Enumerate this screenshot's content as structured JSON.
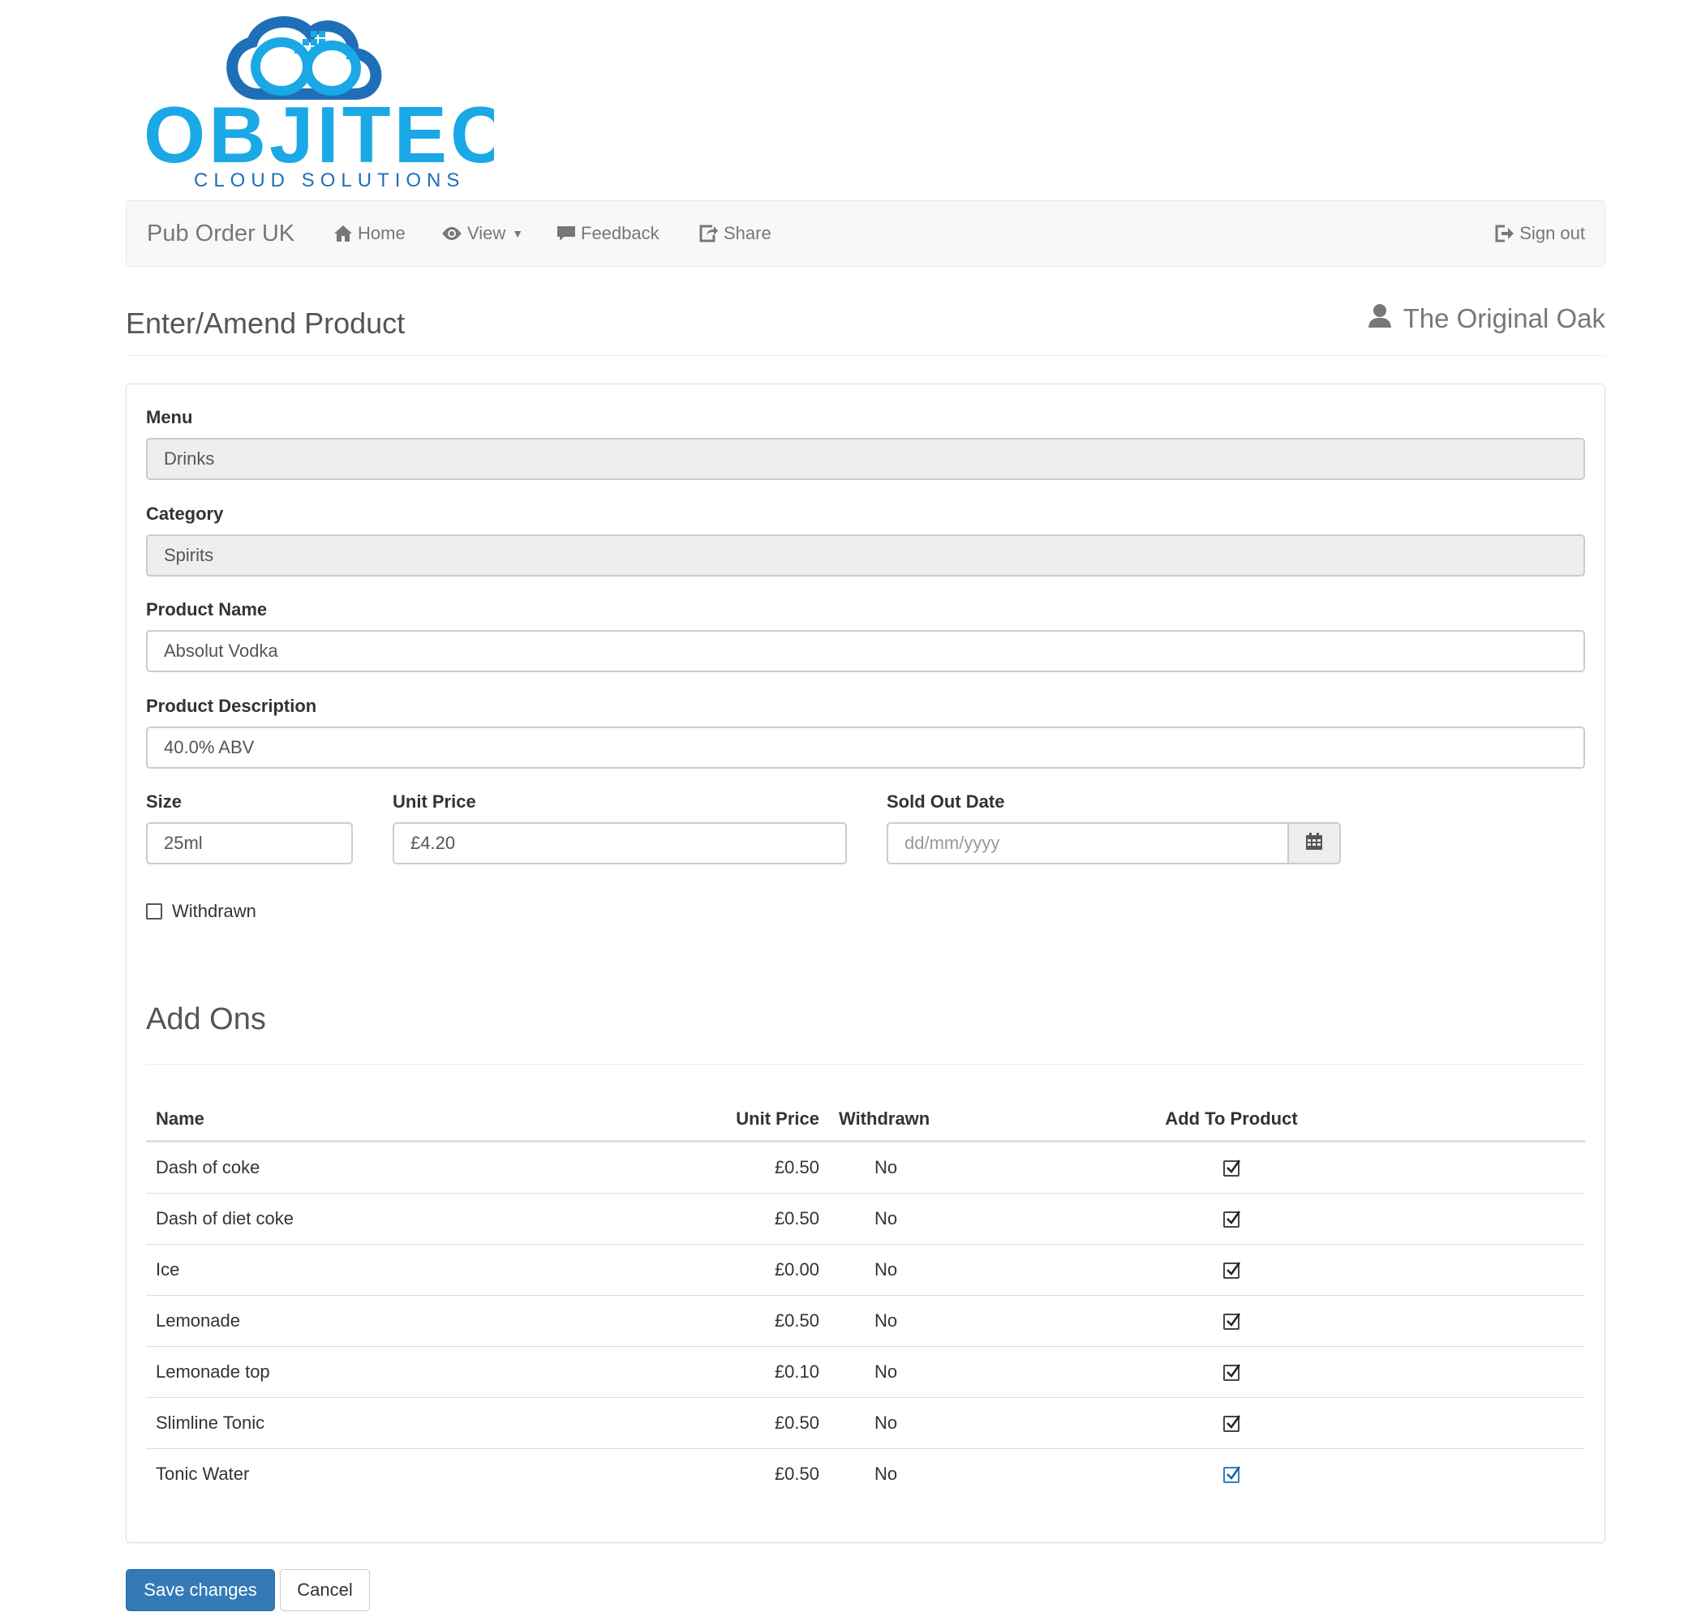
{
  "logo": {
    "wordmark": "OBJITEC",
    "tagline": "CLOUD SOLUTIONS",
    "colors": {
      "primary": "#1aa8e6",
      "dark": "#1f5aa8"
    }
  },
  "navbar": {
    "brand": "Pub Order UK",
    "items": [
      {
        "label": "Home",
        "icon": "home-icon"
      },
      {
        "label": "View",
        "icon": "eye-icon",
        "dropdown": true
      },
      {
        "label": "Feedback",
        "icon": "comment-icon"
      },
      {
        "label": "Share",
        "icon": "share-icon"
      }
    ],
    "signout": {
      "label": "Sign out",
      "icon": "signout-icon"
    }
  },
  "header": {
    "title": "Enter/Amend Product",
    "venue": "The Original Oak"
  },
  "form": {
    "menu": {
      "label": "Menu",
      "value": "Drinks"
    },
    "category": {
      "label": "Category",
      "value": "Spirits"
    },
    "product_name": {
      "label": "Product Name",
      "value": "Absolut Vodka"
    },
    "product_description": {
      "label": "Product Description",
      "value": "40.0% ABV"
    },
    "size": {
      "label": "Size",
      "value": "25ml"
    },
    "unit_price": {
      "label": "Unit Price",
      "value": "£4.20"
    },
    "sold_out_date": {
      "label": "Sold Out Date",
      "placeholder": "dd/mm/yyyy"
    },
    "withdrawn": {
      "label": "Withdrawn",
      "checked": false
    }
  },
  "addons": {
    "title": "Add Ons",
    "columns": [
      "Name",
      "Unit Price",
      "Withdrawn",
      "Add To Product"
    ],
    "rows": [
      {
        "name": "Dash of coke",
        "price": "£0.50",
        "withdrawn": "No",
        "added": true
      },
      {
        "name": "Dash of diet coke",
        "price": "£0.50",
        "withdrawn": "No",
        "added": true
      },
      {
        "name": "Ice",
        "price": "£0.00",
        "withdrawn": "No",
        "added": true
      },
      {
        "name": "Lemonade",
        "price": "£0.50",
        "withdrawn": "No",
        "added": true
      },
      {
        "name": "Lemonade top",
        "price": "£0.10",
        "withdrawn": "No",
        "added": true
      },
      {
        "name": "Slimline Tonic",
        "price": "£0.50",
        "withdrawn": "No",
        "added": true
      },
      {
        "name": "Tonic Water",
        "price": "£0.50",
        "withdrawn": "No",
        "added": true
      }
    ]
  },
  "buttons": {
    "save": "Save changes",
    "cancel": "Cancel"
  },
  "colors": {
    "primary_button": "#337ab7",
    "navbar_bg": "#f8f8f8",
    "focused_checkbox": "#2a7fc7"
  }
}
